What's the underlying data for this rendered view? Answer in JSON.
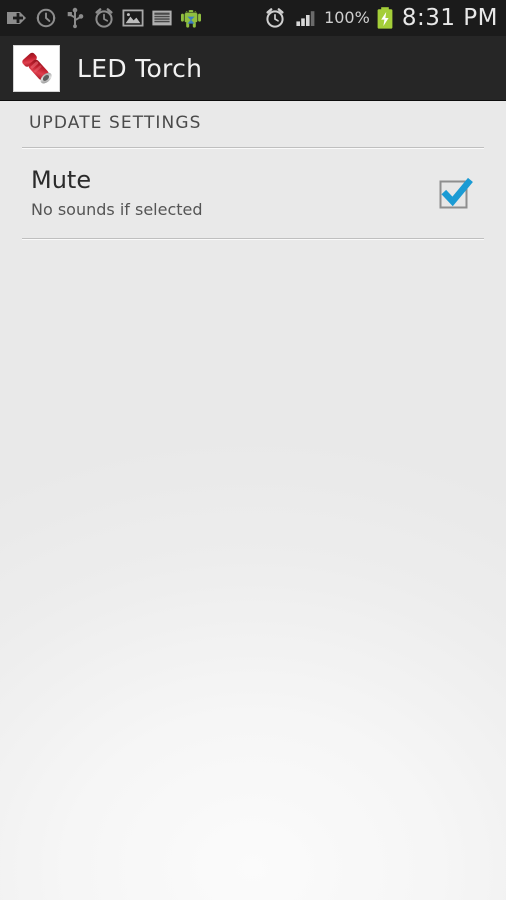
{
  "status_bar": {
    "background_color": "#1b1b1b",
    "notification_icons": [
      {
        "name": "add-plus-icon",
        "label": "Add"
      },
      {
        "name": "compass-navigation-icon",
        "label": "Navigation"
      },
      {
        "name": "usb-icon",
        "label": "USB connected"
      },
      {
        "name": "alarm-clock-icon",
        "label": "Alarm set"
      },
      {
        "name": "image-photo-icon",
        "label": "Screenshot captured"
      },
      {
        "name": "list-document-icon",
        "label": "Document"
      },
      {
        "name": "android-robot-icon",
        "label": "Android system"
      }
    ],
    "system_icons": [
      {
        "name": "alarm-clock-icon",
        "label": "Alarm"
      },
      {
        "name": "signal-bars-icon",
        "label": "Signal strength",
        "bars_filled": 3,
        "bars_total": 4
      }
    ],
    "battery_percent": "100%",
    "battery_icon": "battery-charging-icon",
    "battery_color": "#a4ce39",
    "time": "8:31 PM"
  },
  "action_bar": {
    "background_color": "#262626",
    "app_icon": "flashlight-torch-icon",
    "app_icon_color": "#cc2936",
    "title": "LED Torch"
  },
  "content": {
    "section_header": "UPDATE SETTINGS",
    "preferences": [
      {
        "name": "mute",
        "title": "Mute",
        "summary": "No sounds if selected",
        "control": "checkbox",
        "checked": true,
        "check_color": "#1b9bd4"
      }
    ]
  }
}
